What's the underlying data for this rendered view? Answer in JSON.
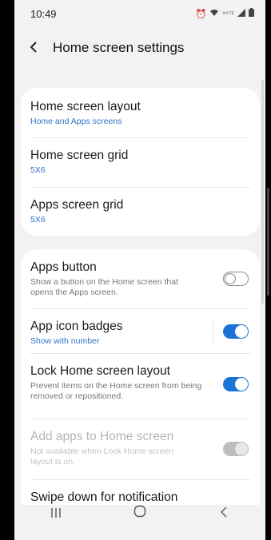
{
  "status_bar": {
    "time": "10:49",
    "icons": [
      "alarm-icon",
      "wifi-icon",
      "volte-icon",
      "signal-icon",
      "battery-icon"
    ],
    "volte_text": "VoLTE"
  },
  "app_bar": {
    "title": "Home screen settings"
  },
  "card1": {
    "items": [
      {
        "title": "Home screen layout",
        "subtitle": "Home and Apps screens"
      },
      {
        "title": "Home screen grid",
        "subtitle": "5X6"
      },
      {
        "title": "Apps screen grid",
        "subtitle": "5X6"
      }
    ]
  },
  "card2": {
    "items": [
      {
        "title": "Apps button",
        "description": "Show a button on the Home screen that opens the Apps screen.",
        "toggle": "off"
      },
      {
        "title": "App icon badges",
        "subtitle": "Show with number",
        "toggle": "on"
      },
      {
        "title": "Lock Home screen layout",
        "description": "Prevent items on the Home screen from being removed or repositioned.",
        "toggle": "on"
      },
      {
        "title": "Add apps to Home screen",
        "description": "Not available when Lock Home screen layout is on.",
        "toggle": "on-disabled"
      },
      {
        "title": "Swipe down for notification"
      }
    ]
  },
  "colors": {
    "accent": "#1a74d6",
    "background": "#f2f2f2",
    "card": "#ffffff"
  },
  "nav_bar": {
    "buttons": [
      "recents-icon",
      "home-icon",
      "back-icon"
    ]
  }
}
